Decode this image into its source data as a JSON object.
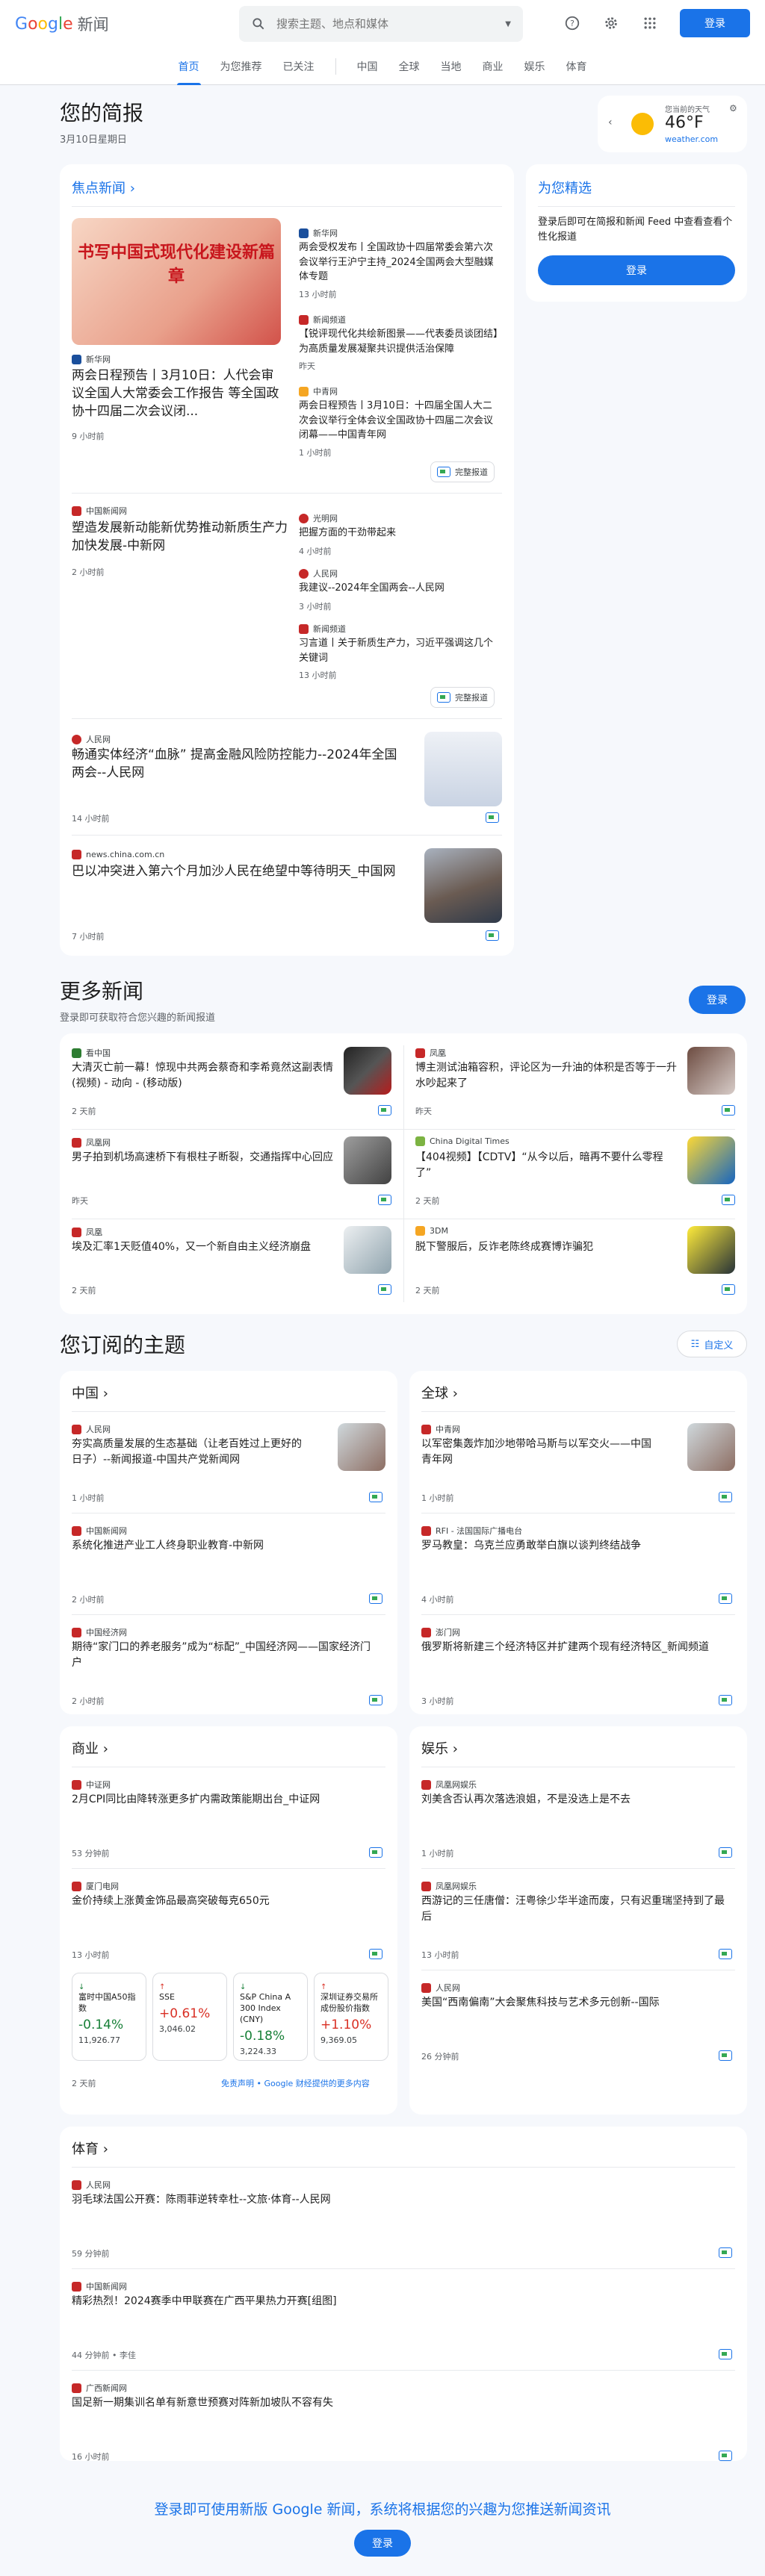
{
  "header": {
    "logo_google": "Google",
    "logo_news": "新闻",
    "search_placeholder": "搜索主题、地点和媒体",
    "login": "登录"
  },
  "tabs": [
    "首页",
    "为您推荐",
    "已关注",
    "中国",
    "全球",
    "当地",
    "商业",
    "娱乐",
    "体育"
  ],
  "briefing": {
    "title": "您的简报",
    "date": "3月10日星期日"
  },
  "weather": {
    "label": "您当前的天气",
    "temp": "46°F",
    "source": "weather.com"
  },
  "focus": {
    "title": "焦点新闻",
    "main": {
      "source": "新华网",
      "title": "两会日程预告丨3月10日：人代会审议全国人大常委会工作报告 等全国政协十四届二次会议闭...",
      "time": "9 小时前",
      "img_text": "书写中国式现代化建设新篇章"
    },
    "side": [
      {
        "source": "新华网",
        "title": "两会受权发布丨全国政协十四届常委会第六次会议举行王沪宁主持_2024全国两会大型融媒体专题",
        "time": "13 小时前"
      },
      {
        "source": "新闻频道",
        "title": "【锐评现代化共绘新图景——代表委员谈团结】为高质量发展凝聚共识提供活治保障",
        "time": "昨天"
      },
      {
        "source": "中青网",
        "title": "两会日程预告丨3月10日：十四届全国人大二次会议举行全体会议全国政协十四届二次会议闭幕——中国青年网",
        "time": "1 小时前"
      }
    ],
    "cov": "完整报道",
    "g2": {
      "source": "中国新闻网",
      "title": "塑造发展新动能新优势推动新质生产力加快发展-中新网",
      "time": "2 小时前",
      "side": [
        {
          "source": "光明网",
          "title": "把握方面的干劲带起来",
          "time": "4 小时前"
        },
        {
          "source": "人民网",
          "title": "我建议--2024年全国两会--人民网",
          "time": "3 小时前"
        },
        {
          "source": "新闻频道",
          "title": "习言道丨关于新质生产力，习近平强调这几个关键词",
          "time": "13 小时前"
        }
      ]
    },
    "g3": {
      "source": "人民网",
      "title": "畅通实体经济“血脉” 提高金融风险防控能力--2024年全国两会--人民网",
      "time": "14 小时前"
    },
    "g4": {
      "source": "news.china.com.cn",
      "title": "巴以冲突进入第六个月加沙人民在绝望中等待明天_中国网",
      "time": "7 小时前"
    }
  },
  "foryou": {
    "title": "为您精选",
    "desc": "登录后即可在简报和新闻 Feed 中查看查看个性化报道",
    "login": "登录"
  },
  "more": {
    "title": "更多新闻",
    "sub": "登录即可获取符合您兴趣的新闻报道",
    "login": "登录",
    "items": [
      {
        "source": "看中国",
        "title": "大清灭亡前一幕！惊现中共两会蔡奇和李希竟然这副表情(视频) - 动向 - (移动版)",
        "time": "2 天前"
      },
      {
        "source": "凤凰",
        "title": "博主测试油箱容积，评论区为一升油的体积是否等于一升水吵起来了",
        "time": "昨天"
      },
      {
        "source": "凤凰网",
        "title": "男子拍到机场高速桥下有根柱子断裂，交通指挥中心回应",
        "time": "昨天"
      },
      {
        "source": "China Digital Times",
        "title": "【404视频】【CDTV】“从今以后，暗再不要什么零程了”",
        "time": "2 天前"
      },
      {
        "source": "凤凰",
        "title": "埃及汇率1天贬值40%，又一个新自由主义经济崩盘",
        "time": "2 天前"
      },
      {
        "source": "3DM",
        "title": "脱下警服后，反诈老陈终成赛博诈骗犯",
        "time": "2 天前"
      }
    ]
  },
  "topics": {
    "title": "您订阅的主题",
    "customize": "自定义",
    "china": {
      "title": "中国",
      "items": [
        {
          "source": "人民网",
          "title": "夯实高质量发展的生态基础（让老百姓过上更好的日子）--新闻报道-中国共产党新闻网",
          "time": "1 小时前"
        },
        {
          "source": "中国新闻网",
          "title": "系统化推进产业工人终身职业教育-中新网",
          "time": "2 小时前"
        },
        {
          "source": "中国经济网",
          "title": "期待“家门口的养老服务”成为“标配”_中国经济网——国家经济门户",
          "time": "2 小时前"
        }
      ]
    },
    "world": {
      "title": "全球",
      "items": [
        {
          "source": "中青网",
          "title": "以军密集轰炸加沙地带哈马斯与以军交火——中国青年网",
          "time": "1 小时前"
        },
        {
          "source": "RFI - 法国国际广播电台",
          "title": "罗马教皇：乌克兰应勇敢举白旗以谈判终结战争",
          "time": "4 小时前"
        },
        {
          "source": "澎门网",
          "title": "俄罗斯将新建三个经济特区并扩建两个现有经济特区_新闻频道",
          "time": "3 小时前"
        }
      ]
    },
    "business": {
      "title": "商业",
      "items": [
        {
          "source": "中证网",
          "title": "2月CPI同比由降转涨更多扩内需政策能期出台_中证网",
          "time": "53 分钟前"
        },
        {
          "source": "厦门电网",
          "title": "金价持续上涨黄金饰品最高突破每克650元",
          "time": "13 小时前"
        }
      ],
      "stocks": [
        {
          "name": "富时中国A50指数",
          "change": "-0.14%",
          "dir": "down",
          "value": "11,926.77"
        },
        {
          "name": "SSE",
          "change": "+0.61%",
          "dir": "up",
          "value": "3,046.02"
        },
        {
          "name": "S&P China A 300 Index (CNY)",
          "change": "-0.18%",
          "dir": "down",
          "value": "3,224.33"
        },
        {
          "name": "深圳证券交易所成份股价指数",
          "change": "+1.10%",
          "dir": "up",
          "value": "9,369.05"
        }
      ],
      "time": "2 天前",
      "disclaimer": "免责声明 • Google 财经提供的更多内容"
    },
    "ent": {
      "title": "娱乐",
      "items": [
        {
          "source": "凤凰网娱乐",
          "title": "刘美含否认再次落选浪姐，不是没选上是不去",
          "time": "1 小时前"
        },
        {
          "source": "凤凰网娱乐",
          "title": "西游记的三任唐僧：汪粤徐少华半途而废，只有迟重瑞坚持到了最后",
          "time": "13 小时前"
        },
        {
          "source": "人民网",
          "title": "美国“西南偏南”大会聚焦科技与艺术多元创新--国际",
          "time": "26 分钟前"
        }
      ]
    },
    "sports": {
      "title": "体育",
      "items": [
        {
          "source": "人民网",
          "title": "羽毛球法国公开赛：陈雨菲逆转幸杜--文旅·体育--人民网",
          "time": "59 分钟前"
        },
        {
          "source": "中国新闻网",
          "title": "精彩热烈！2024赛季中甲联赛在广西平果热力开赛[组图]",
          "time": "44 分钟前 • 李佳"
        },
        {
          "source": "广西新闻网",
          "title": "国足新一期集训名单有新意世预赛对阵新加坡队不容有失",
          "time": "16 小时前"
        }
      ]
    }
  },
  "footer": {
    "text": "登录即可使用新版 Google 新闻，系统将根据您的兴趣为您推送新闻资讯",
    "login": "登录"
  }
}
